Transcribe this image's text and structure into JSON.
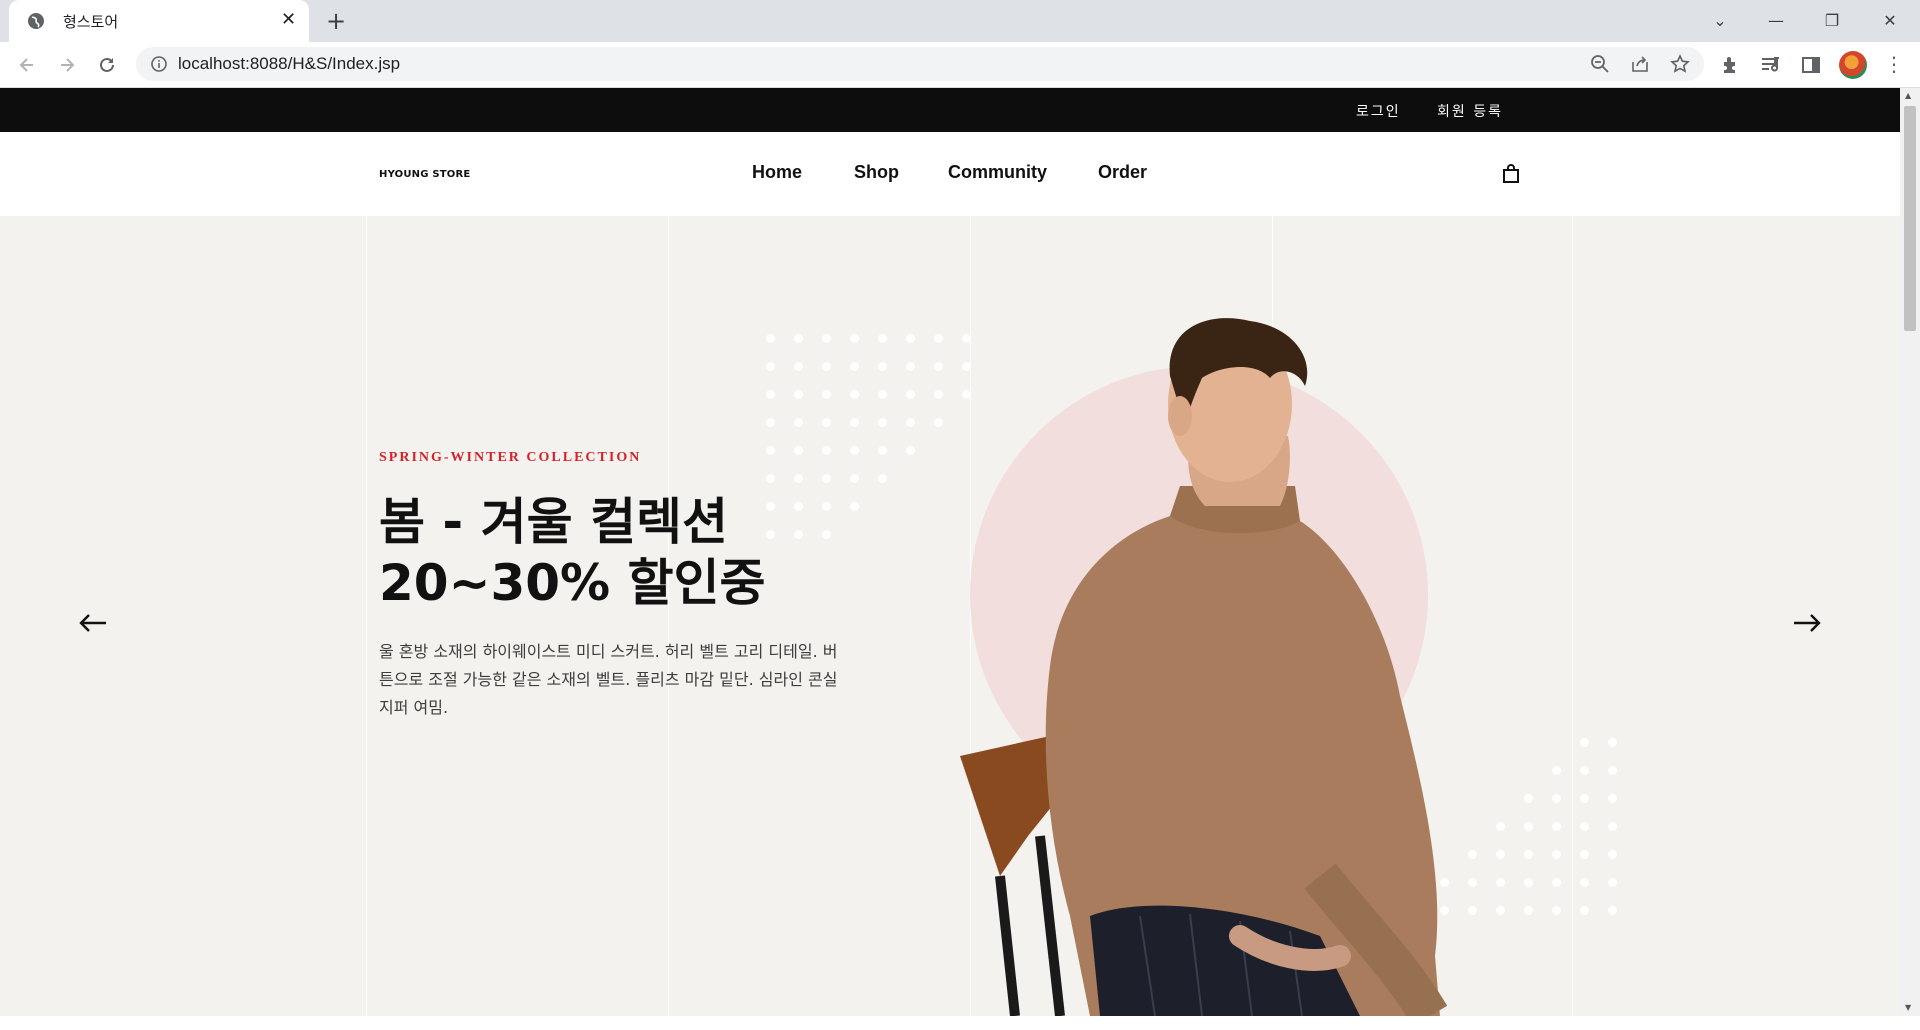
{
  "browser": {
    "tab_title": "형스토어",
    "tab_close": "✕",
    "new_tab": "+",
    "url": "localhost:8088/H&S/Index.jsp",
    "window_controls": {
      "dropdown": "⌄",
      "minimize": "—",
      "restore": "❐",
      "close": "✕"
    }
  },
  "site": {
    "topbar": {
      "login": "로그인",
      "register": "회원 등록"
    },
    "logo": "HYOUNG STORE",
    "nav": [
      "Home",
      "Shop",
      "Community",
      "Order"
    ],
    "hero": {
      "subtitle": "SPRING-WINTER COLLECTION",
      "headline_line1": "봄 - 겨울 컬렉션",
      "headline_line2": "20~30% 할인중",
      "description": "울 혼방 소재의 하이웨이스트 미디 스커트. 허리 벨트 고리 디테일. 버튼으로 조절 가능한 같은 소재의 벨트. 플리츠 마감 밑단. 심라인 콘실 지퍼 여밈."
    }
  },
  "colors": {
    "accent_red": "#d3242a",
    "topbar": "#0d0d0d",
    "hero_bg": "#f3f2ee",
    "circle": "#f1dedd",
    "sweater": "#a87c5c"
  },
  "icons": [
    "globe-icon",
    "back-icon",
    "forward-icon",
    "reload-icon",
    "info-icon",
    "zoom-icon",
    "share-icon",
    "star-icon",
    "extensions-icon",
    "media-icon",
    "sidepanel-icon",
    "shopping-bag-icon",
    "arrow-left-icon",
    "arrow-right-icon"
  ]
}
